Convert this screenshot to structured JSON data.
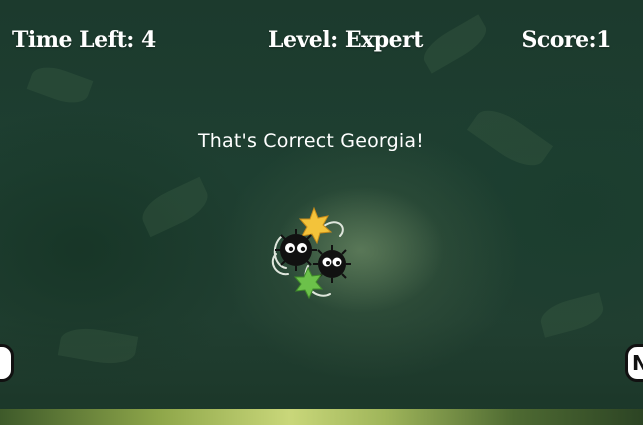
{
  "hud": {
    "time_left": "Time Left: 4",
    "level": "Level: Expert",
    "score": "Score:1"
  },
  "feedback": {
    "message": "That's Correct Georgia!"
  },
  "navigation": {
    "prev_label": "",
    "next_label": "N"
  },
  "mascot": {
    "icon": "soot-sprites-with-konpeito-icon",
    "colors": {
      "soot": "#111111",
      "star_yellow": "#f3c33a",
      "star_green": "#6cc14a"
    }
  },
  "theme": {
    "background": "#1f3b2e",
    "text": "#ffffff"
  }
}
